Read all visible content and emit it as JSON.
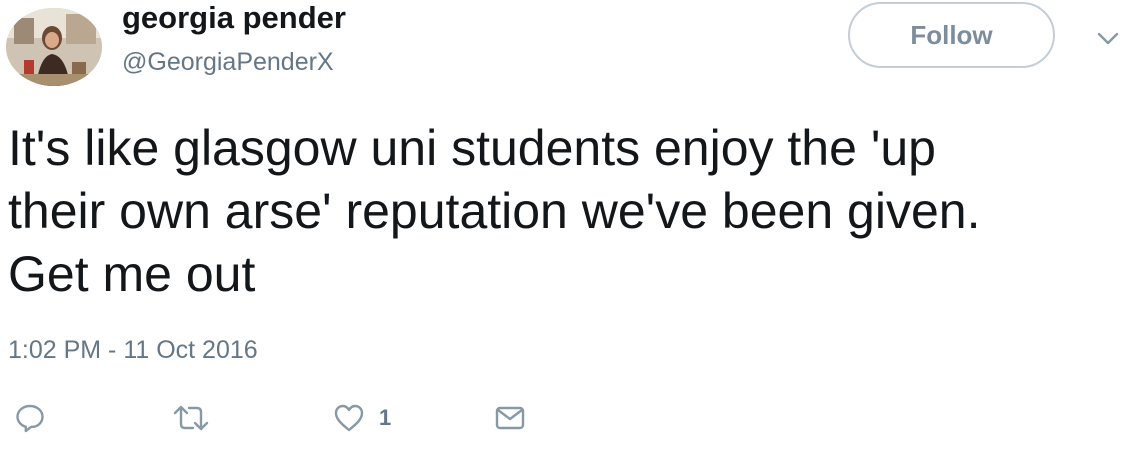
{
  "user": {
    "display_name": "georgia pender",
    "handle": "@GeorgiaPenderX",
    "avatar_icon": "profile-photo"
  },
  "follow_button": {
    "label": "Follow"
  },
  "tweet": {
    "lines": [
      "It's like glasgow uni students enjoy the 'up",
      "their own arse' reputation we've been given.",
      "Get me out"
    ],
    "timestamp": "1:02 PM - 11 Oct 2016"
  },
  "actions": {
    "reply_icon": "reply-icon",
    "retweet_icon": "retweet-icon",
    "like_icon": "heart-icon",
    "like_count": "1",
    "dm_icon": "envelope-icon"
  },
  "colors": {
    "text": "#14171a",
    "secondary": "#657786",
    "icon": "#8899a6",
    "follow_border": "#c3ced6"
  }
}
